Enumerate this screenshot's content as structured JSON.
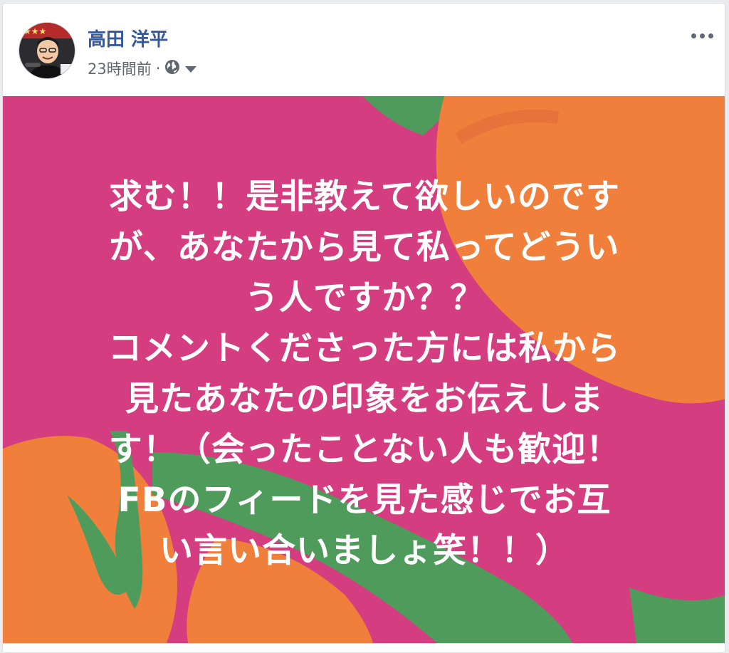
{
  "post": {
    "author": "高田 洋平",
    "timestamp": "23時間前",
    "separator": "·",
    "privacy_icon": "globe-icon",
    "audience_dropdown_icon": "caret-down-icon",
    "more_icon": "more-horizontal-icon",
    "text_lines": [
      "求む！！是非教えて欲しいのです",
      "が、あなたから見て私ってどうい",
      "う人ですか？？",
      "コメントくださった方には私から",
      "見たあなたの印象をお伝えしま",
      "す！（会ったことない人も歓迎！",
      "FBのフィードを見た感じでお互",
      "い言い合いましょ笑！！）"
    ]
  },
  "colors": {
    "background_pink": "#d43d7f",
    "orange": "#ef7f3b",
    "green": "#4e9b5c",
    "author_blue": "#365899"
  }
}
